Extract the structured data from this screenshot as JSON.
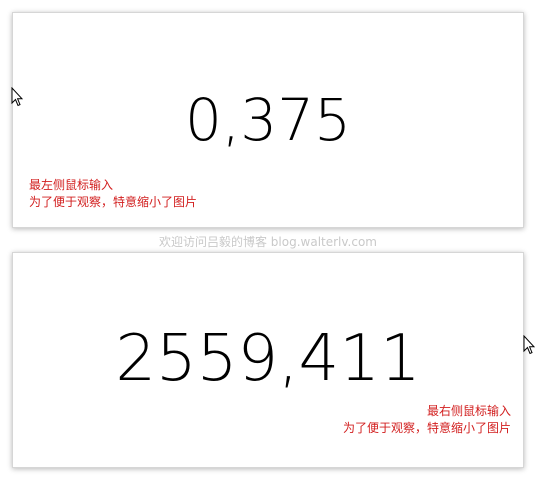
{
  "top_panel": {
    "value": "0,375",
    "note_line1": "最左侧鼠标输入",
    "note_line2": "为了便于观察，特意缩小了图片"
  },
  "watermark": "欢迎访问吕毅的博客 blog.walterlv.com",
  "bottom_panel": {
    "value": "2559,411",
    "note_line1": "最右侧鼠标输入",
    "note_line2": "为了便于观察，特意缩小了图片"
  },
  "icons": {
    "cursor": "mouse-pointer-icon"
  },
  "colors": {
    "note": "#d21f1f",
    "value": "#000000",
    "watermark": "#c9c9c9"
  }
}
